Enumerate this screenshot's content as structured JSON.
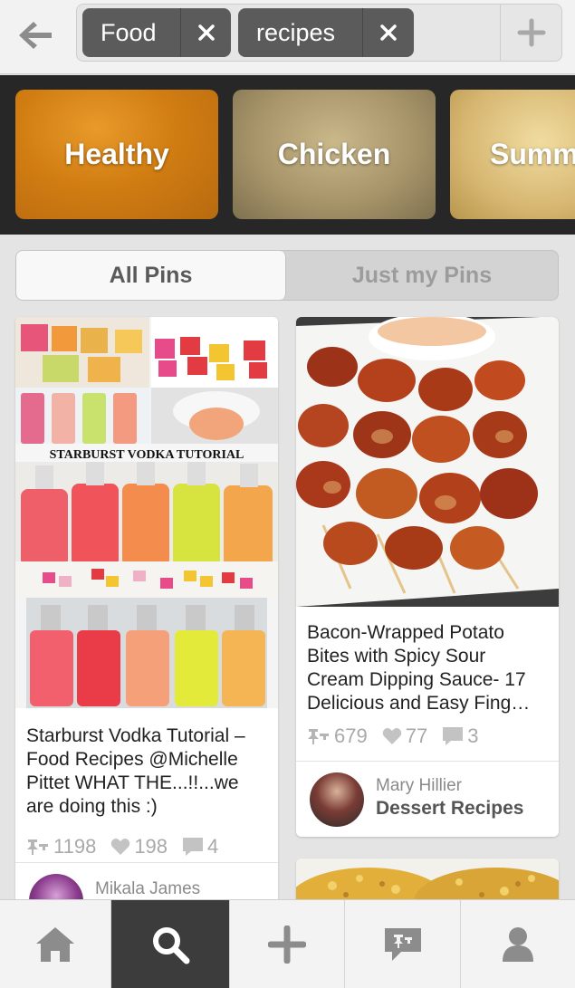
{
  "search": {
    "tokens": [
      "Food",
      "recipes"
    ]
  },
  "categories": [
    "Healthy",
    "Chicken",
    "Summ"
  ],
  "filter": {
    "options": [
      "All Pins",
      "Just my Pins"
    ],
    "selected": "All Pins"
  },
  "pins": [
    {
      "image_caption": "STARBURST VODKA TUTORIAL",
      "description": "Starburst Vodka Tutorial – Food Recipes @Michelle Pittet WHAT THE...!!...we are doing this :)",
      "repins": "1198",
      "likes": "198",
      "comments": "4",
      "pinner_name": "Mikala James"
    },
    {
      "description": "Bacon-Wrapped Potato Bites with Spicy Sour Cream Dipping Sauce- 17 Delicious and Easy Fing…",
      "repins": "679",
      "likes": "77",
      "comments": "3",
      "pinner_name": "Mary Hillier",
      "board": "Dessert Recipes"
    }
  ],
  "tabs": [
    "home",
    "search",
    "add",
    "news",
    "profile"
  ],
  "colors": {
    "active_tab": "#3c3c3c",
    "token": "#5b5b5b",
    "category_strip": "#272727",
    "stat_text": "#a9a9a9"
  }
}
